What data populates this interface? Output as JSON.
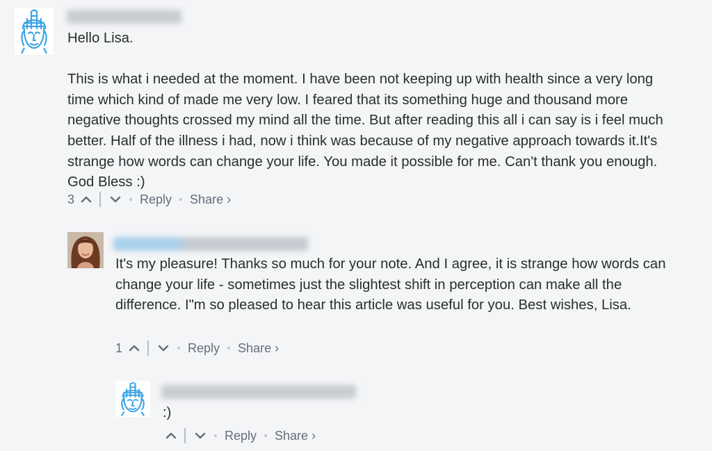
{
  "comments": [
    {
      "avatar_icon": "buddha-icon",
      "author_blurred": true,
      "paragraphs": [
        "Hello Lisa.",
        "This is what i needed at the moment. I have been not keeping up with health since a very long time which kind of made me very low. I feared that its something huge and thousand more negative thoughts crossed my mind all the time. But after reading this all i can say is i feel much better. Half of the illness i had, now i think was because of my negative approach towards it.It's strange how words can change your life. You made it possible for me. Can't thank you enough. God Bless :)"
      ],
      "votes": "3",
      "reply_label": "Reply",
      "share_label": "Share ›"
    },
    {
      "avatar_icon": "profile-photo",
      "author_blurred": true,
      "paragraphs": [
        "It's my pleasure! Thanks so much for your note. And I agree, it is strange how words can change your life - sometimes just the slightest shift in perception can make all the difference. I\"m so pleased to hear this article was useful for you. Best wishes, Lisa."
      ],
      "votes": "1",
      "reply_label": "Reply",
      "share_label": "Share ›"
    },
    {
      "avatar_icon": "buddha-icon",
      "author_blurred": true,
      "paragraphs": [
        ":)"
      ],
      "votes": "",
      "reply_label": "Reply",
      "share_label": "Share ›"
    }
  ],
  "colors": {
    "background": "#f4f5f7",
    "text": "#2a2e2e",
    "meta": "#656c7a",
    "buddha_blue": "#3aa3e3"
  }
}
